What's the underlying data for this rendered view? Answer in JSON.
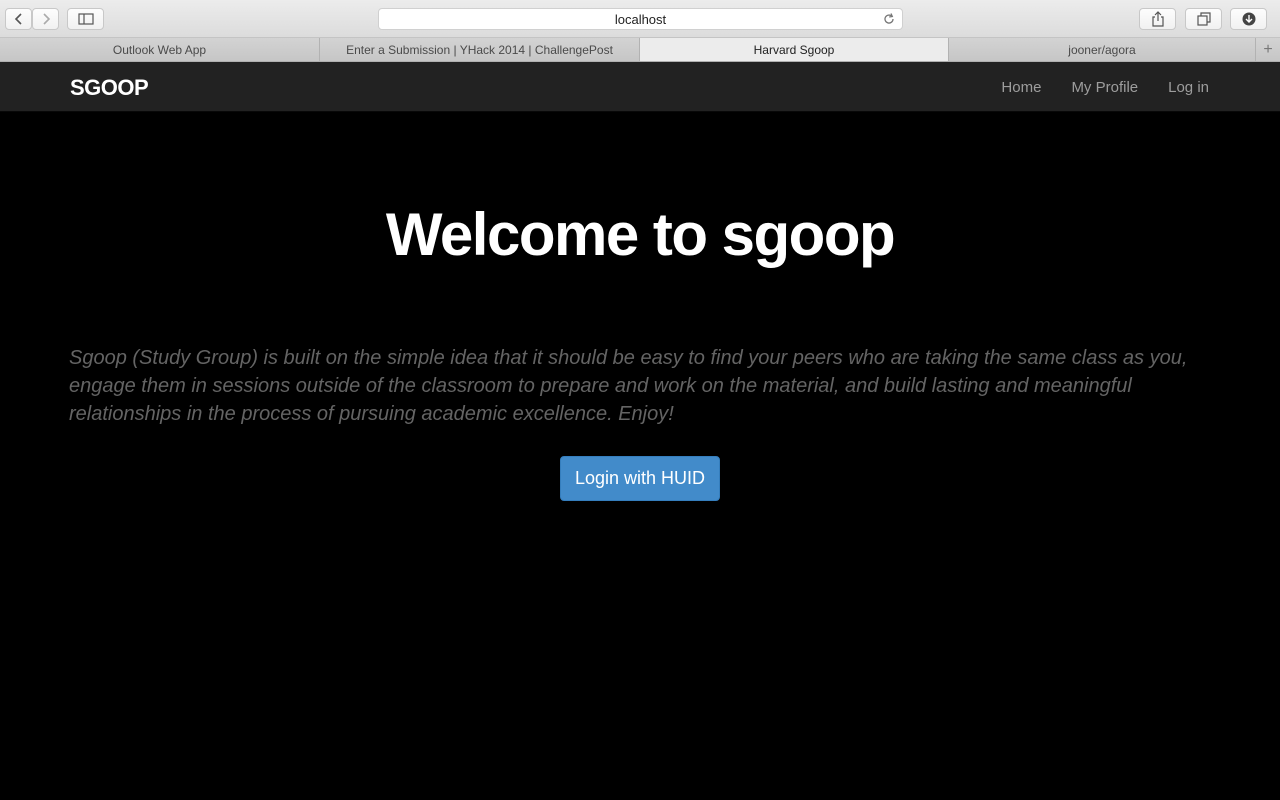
{
  "browser": {
    "address": "localhost",
    "tabs": [
      {
        "label": "Outlook Web App",
        "active": false
      },
      {
        "label": "Enter a Submission | YHack 2014 | ChallengePost",
        "active": false
      },
      {
        "label": "Harvard Sgoop",
        "active": true
      },
      {
        "label": "jooner/agora",
        "active": false
      }
    ],
    "new_tab_symbol": "+"
  },
  "navbar": {
    "brand": "SGOOP",
    "links": [
      "Home",
      "My Profile",
      "Log in"
    ],
    "background": "#222222"
  },
  "hero": {
    "title": "Welcome to sgoop",
    "text": "Sgoop (Study Group) is built on the simple idea that it should be easy to find your peers who are taking the same class as you, engage them in sessions outside of the classroom to prepare and work on the material, and build lasting and meaningful relationships in the process of pursuing academic excellence. Enjoy!",
    "button_label": "Login with HUID",
    "button_color": "#428bca"
  }
}
